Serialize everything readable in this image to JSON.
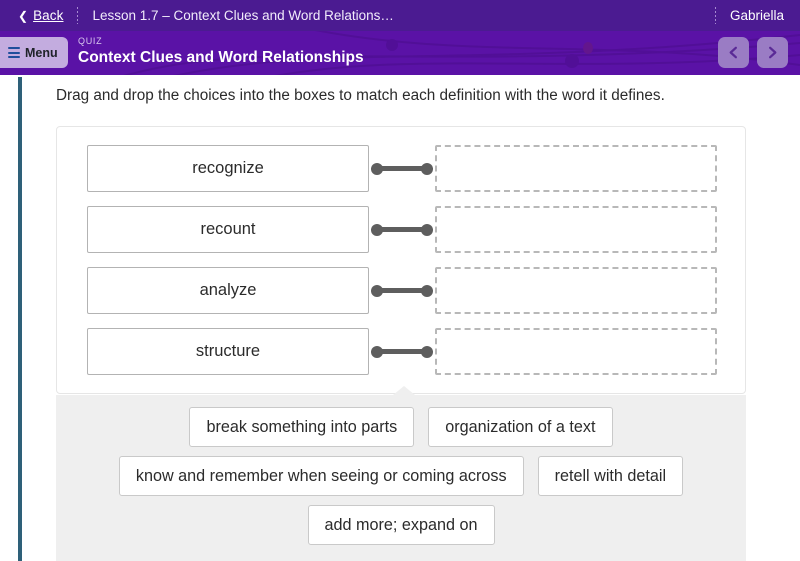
{
  "topbar": {
    "back_label": "Back",
    "back_icon": "chevron-left-icon",
    "lesson_title": "Lesson 1.7 – Context Clues and Word Relations…",
    "user_name": "Gabriella"
  },
  "quizbar": {
    "menu_label": "Menu",
    "menu_icon": "hamburger-list-icon",
    "kicker": "QUIZ",
    "title": "Context Clues and Word Relationships",
    "prev_icon": "chevron-left-icon",
    "next_icon": "chevron-right-icon"
  },
  "main": {
    "instruction": "Drag and drop the choices into the boxes to match each definition with the word it defines.",
    "match_rows": [
      {
        "word": "recognize",
        "answer": ""
      },
      {
        "word": "recount",
        "answer": ""
      },
      {
        "word": "analyze",
        "answer": ""
      },
      {
        "word": "structure",
        "answer": ""
      }
    ],
    "choices": [
      "break something into parts",
      "organization of a text",
      "know and remember when seeing or coming across",
      "retell with detail",
      "add more; expand on"
    ]
  },
  "colors": {
    "topbar_purple": "#4b1b91",
    "quizbar_purple": "#5a12a6",
    "menu_button": "#c3acdf",
    "nav_button": "#9a7cc4",
    "rail_teal": "#2e6079",
    "tray_gray": "#efefef",
    "connector_gray": "#5e5e5e"
  }
}
